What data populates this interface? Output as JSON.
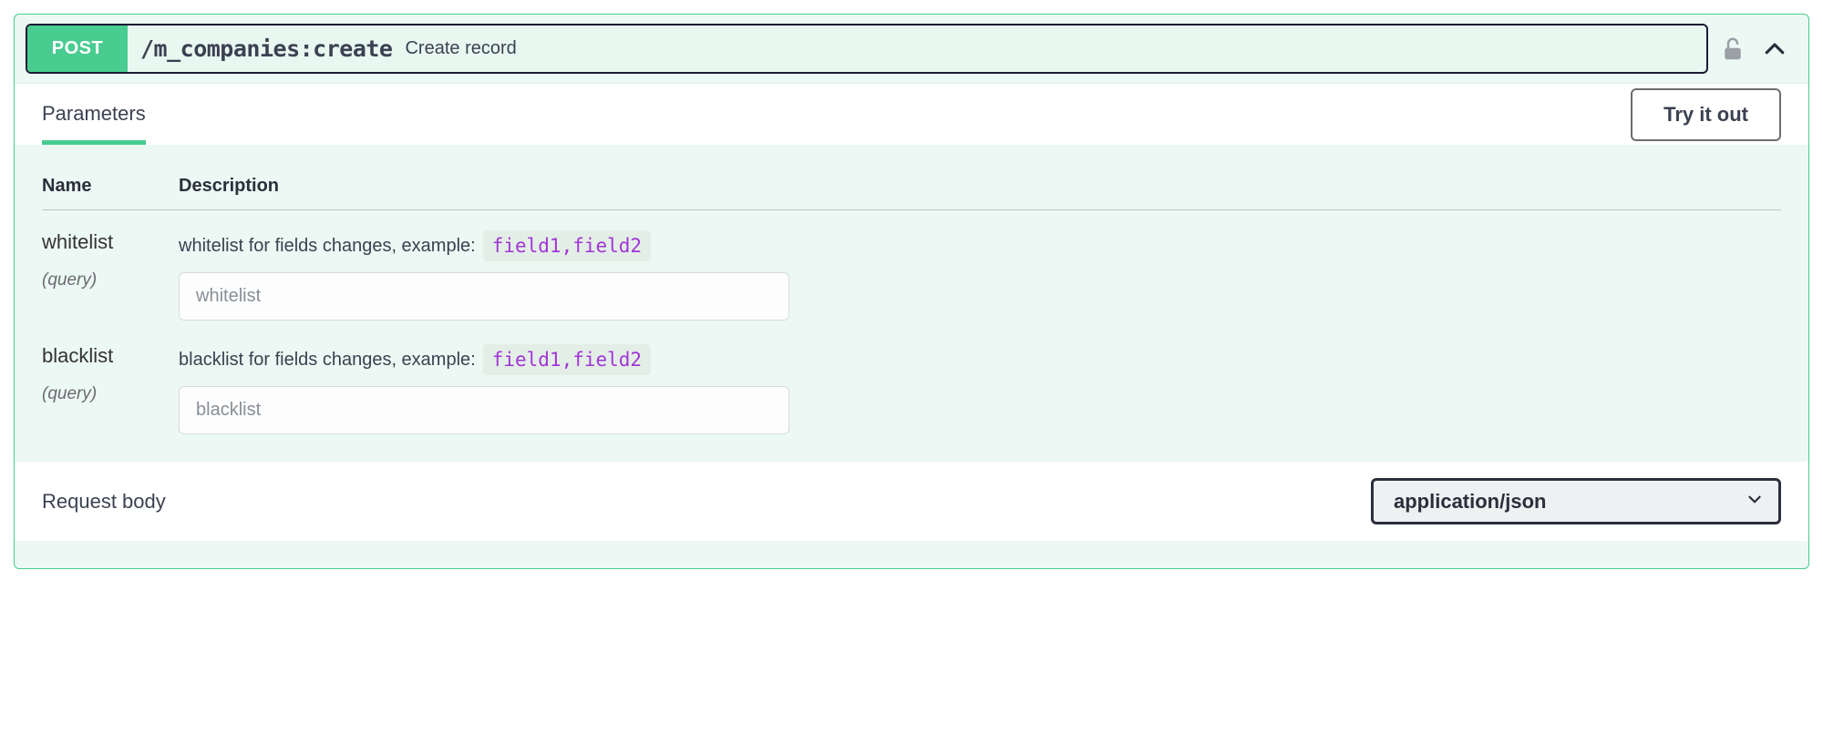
{
  "operation": {
    "method": "POST",
    "path": "/m_companies:create",
    "summary": "Create record"
  },
  "tabs": {
    "parameters": "Parameters"
  },
  "buttons": {
    "try_it_out": "Try it out"
  },
  "table": {
    "name_header": "Name",
    "description_header": "Description"
  },
  "parameters": [
    {
      "name": "whitelist",
      "in": "(query)",
      "description": "whitelist for fields changes, example:",
      "example_code": "field1,field2",
      "placeholder": "whitelist"
    },
    {
      "name": "blacklist",
      "in": "(query)",
      "description": "blacklist for fields changes, example:",
      "example_code": "field1,field2",
      "placeholder": "blacklist"
    }
  ],
  "request_body": {
    "title": "Request body",
    "content_type": "application/json"
  }
}
